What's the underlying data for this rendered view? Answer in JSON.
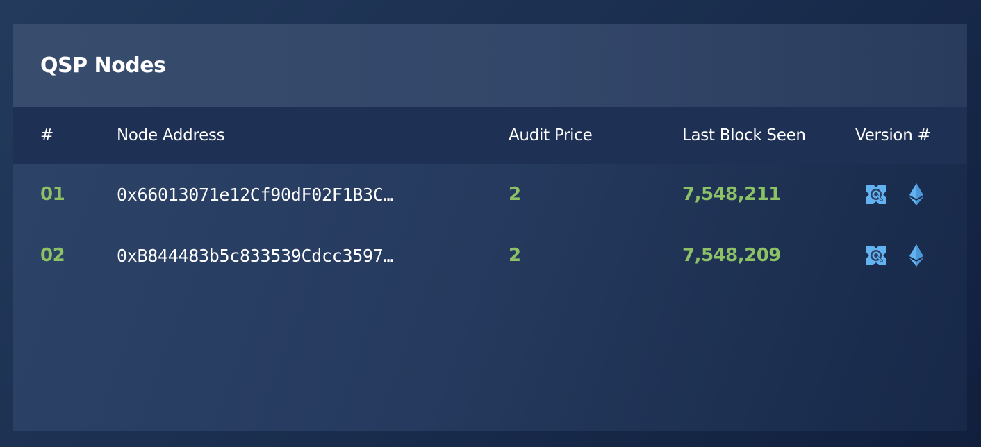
{
  "panel": {
    "title": "QSP Nodes"
  },
  "table": {
    "columns": [
      "#",
      "Node Address",
      "Audit Price",
      "Last Block Seen",
      "Version #"
    ],
    "rows": [
      {
        "num": "01",
        "address": "0x66013071e12Cf90dF02F1B3C…",
        "audit_price": "2",
        "last_block": "7,548,211",
        "version_icons": [
          "quantstamp-icon",
          "ethereum-icon"
        ]
      },
      {
        "num": "02",
        "address": "0xB844483b5c833539Cdcc3597…",
        "audit_price": "2",
        "last_block": "7,548,209",
        "version_icons": [
          "quantstamp-icon",
          "ethereum-icon"
        ]
      }
    ]
  },
  "colors": {
    "accent_green": "#8cc265",
    "icon_blue": "#62b3f0",
    "header_bg": "#1e3053"
  }
}
